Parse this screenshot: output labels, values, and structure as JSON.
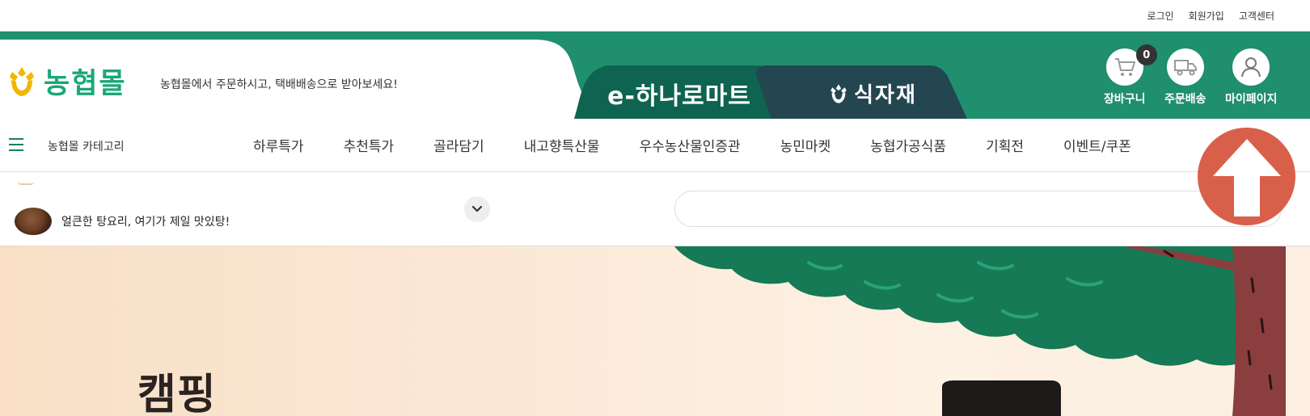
{
  "util": {
    "login": "로그인",
    "join": "회원가입",
    "support": "고객센터"
  },
  "header": {
    "logo_text": "농협몰",
    "slogan": "농협몰에서 주문하시고, 택배배송으로 받아보세요!",
    "tab_hanaro": "e-하나로마트",
    "tab_food": "식자재",
    "cart_label": "장바구니",
    "cart_count": "0",
    "order_label": "주문배송",
    "mypage_label": "마이페이지"
  },
  "nav": {
    "category_label": "농협몰 카테고리",
    "items": [
      "하루특가",
      "추천특가",
      "골라담기",
      "내고향특산물",
      "우수농산물인증관",
      "농민마켓",
      "농협가공식품",
      "기획전",
      "이벤트/쿠폰"
    ]
  },
  "search": {
    "rolling_text": "얼큰한 탕요리, 여기가 제일 맛있탕!",
    "placeholder": ""
  },
  "banner": {
    "title": "캠핑"
  },
  "colors": {
    "brand_green": "#1f8f6d",
    "dark_green": "#0e6450",
    "navy_tab": "#234651",
    "logo_green": "#1aa77a",
    "scroll_top": "#d8604a"
  },
  "icons": {
    "hamburger": "menu-icon",
    "cart": "cart-icon",
    "truck": "truck-icon",
    "user": "user-icon",
    "chevron": "chevron-down-icon",
    "scroll_top": "arrow-up-icon"
  }
}
